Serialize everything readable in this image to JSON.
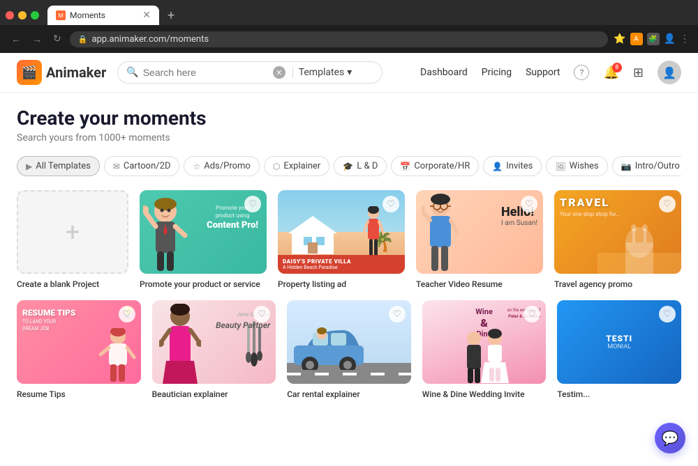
{
  "browser": {
    "tab_title": "Moments",
    "url": "app.animaker.com/moments",
    "new_tab_label": "+",
    "nav_back": "←",
    "nav_forward": "→",
    "nav_refresh": "↻"
  },
  "header": {
    "logo_text": "Animaker",
    "search_placeholder": "Search here",
    "template_dropdown_label": "Templates",
    "nav_dashboard": "Dashboard",
    "nav_pricing": "Pricing",
    "nav_support": "Support",
    "notif_count": "8"
  },
  "hero": {
    "title": "Create your moments",
    "subtitle": "Search yours from 1000+ moments"
  },
  "categories": [
    {
      "id": "all",
      "label": "All Templates",
      "icon": "▶",
      "active": true
    },
    {
      "id": "cartoon",
      "label": "Cartoon/2D",
      "icon": "✉"
    },
    {
      "id": "ads",
      "label": "Ads/Promo",
      "icon": "☆"
    },
    {
      "id": "explainer",
      "label": "Explainer",
      "icon": "⬡"
    },
    {
      "id": "ld",
      "label": "L & D",
      "icon": "🎓"
    },
    {
      "id": "corporate",
      "label": "Corporate/HR",
      "icon": "📅"
    },
    {
      "id": "invites",
      "label": "Invites",
      "icon": "👤"
    },
    {
      "id": "wishes",
      "label": "Wishes",
      "icon": "🖼"
    },
    {
      "id": "intro",
      "label": "Intro/Outro",
      "icon": "📷"
    }
  ],
  "templates_row1": [
    {
      "id": "blank",
      "label": "Create a blank Project",
      "type": "blank"
    },
    {
      "id": "promote",
      "label": "Promote your product or service",
      "type": "promote"
    },
    {
      "id": "property",
      "label": "Property listing ad",
      "type": "property",
      "overlay_line1": "DAISY'S PRIVATE VILLA",
      "overlay_line2": "A Hidden Beach Paradise"
    },
    {
      "id": "teacher",
      "label": "Teacher Video Resume",
      "type": "teacher"
    },
    {
      "id": "travel",
      "label": "Travel agency promo",
      "type": "travel"
    }
  ],
  "templates_row2": [
    {
      "id": "resume",
      "label": "Resume Tips",
      "type": "resume",
      "text1": "RESUME TIPS",
      "text2": "TO LAND YOUR DREAM JOB"
    },
    {
      "id": "beauty",
      "label": "Beautician explainer",
      "type": "beauty"
    },
    {
      "id": "car",
      "label": "Car rental explainer",
      "type": "car"
    },
    {
      "id": "wine",
      "label": "Wine & Dine Wedding Invite",
      "type": "wine"
    },
    {
      "id": "testi",
      "label": "Testim...",
      "type": "testi"
    }
  ]
}
